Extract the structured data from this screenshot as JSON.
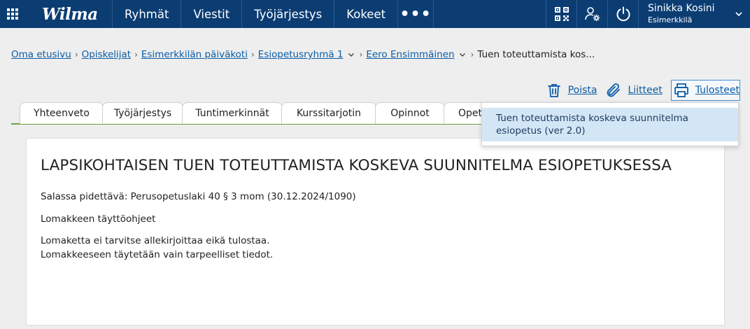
{
  "header": {
    "logo": "Wilma",
    "nav": [
      "Ryhmät",
      "Viestit",
      "Työjärjestys",
      "Kokeet"
    ],
    "more": "•••",
    "user_name": "Sinikka Kosini",
    "user_org": "Esimerkkilä"
  },
  "breadcrumb": {
    "items": [
      "Oma etusivu",
      "Opiskelijat",
      "Esimerkkilän päiväkoti",
      "Esiopetusryhmä 1",
      "Eero Ensimmäinen"
    ],
    "current": "Tuen toteuttamista kos..."
  },
  "actions": {
    "delete": "Poista",
    "attachments": "Liitteet",
    "prints": "Tulosteet"
  },
  "tabs": [
    "Yhteenveto",
    "Työjärjestys",
    "Tuntimerkinnät",
    "Kurssitarjotin",
    "Opinnot",
    "Opet"
  ],
  "dropdown": {
    "items": [
      "Tuen toteuttamista koskeva suunnitelma esiopetus (ver 2.0)"
    ]
  },
  "document": {
    "title": "LAPSIKOHTAISEN TUEN TOTEUTTAMISTA KOSKEVA SUUNNITELMA ESIOPETUKSESSA",
    "confidential": "Salassa pidettävä: Perusopetuslaki 40 § 3 mom (30.12.2024/1090)",
    "instructions_heading": "Lomakkeen täyttöohjeet",
    "instruction_1": "Lomaketta ei tarvitse allekirjoittaa eikä tulostaa.",
    "instruction_2": "Lomakkeeseen täytetään vain tarpeelliset tiedot."
  },
  "colors": {
    "topbar": "#0b3d73",
    "link": "#0a5ca6",
    "tab_underline": "#6aa33a",
    "dropdown_highlight": "#d3e6f6"
  }
}
